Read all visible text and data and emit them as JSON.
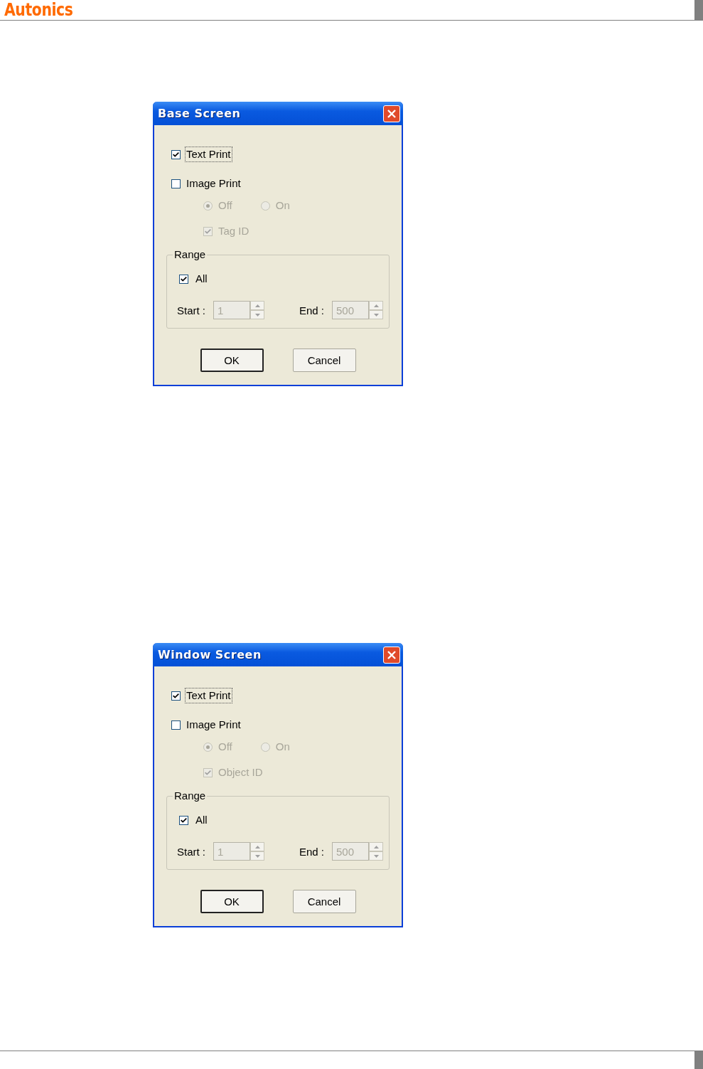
{
  "header": {
    "logo": "Autonics"
  },
  "dialogs": [
    {
      "title": "Base Screen",
      "text_print": {
        "label": "Text Print",
        "checked": true,
        "focused": true
      },
      "image_print": {
        "label": "Image Print",
        "checked": false,
        "focused": false
      },
      "mode_options": [
        {
          "label": "Off",
          "selected": true,
          "disabled": true
        },
        {
          "label": "On",
          "selected": false,
          "disabled": true
        }
      ],
      "id_option": {
        "label": "Tag ID",
        "checked": true,
        "disabled": true
      },
      "range": {
        "legend": "Range",
        "all": {
          "label": "All",
          "checked": true
        },
        "start": {
          "label": "Start :",
          "value": "1",
          "disabled": true
        },
        "end": {
          "label": "End :",
          "value": "500",
          "disabled": true
        }
      },
      "buttons": [
        {
          "label": "OK",
          "default": true
        },
        {
          "label": "Cancel",
          "default": false
        }
      ]
    },
    {
      "title": "Window Screen",
      "text_print": {
        "label": "Text Print",
        "checked": true,
        "focused": true
      },
      "image_print": {
        "label": "Image Print",
        "checked": false,
        "focused": false
      },
      "mode_options": [
        {
          "label": "Off",
          "selected": true,
          "disabled": true
        },
        {
          "label": "On",
          "selected": false,
          "disabled": true
        }
      ],
      "id_option": {
        "label": "Object ID",
        "checked": true,
        "disabled": true
      },
      "range": {
        "legend": "Range",
        "all": {
          "label": "All",
          "checked": true
        },
        "start": {
          "label": "Start :",
          "value": "1",
          "disabled": true
        },
        "end": {
          "label": "End :",
          "value": "500",
          "disabled": true
        }
      },
      "buttons": [
        {
          "label": "OK",
          "default": true
        },
        {
          "label": "Cancel",
          "default": false
        }
      ]
    }
  ]
}
